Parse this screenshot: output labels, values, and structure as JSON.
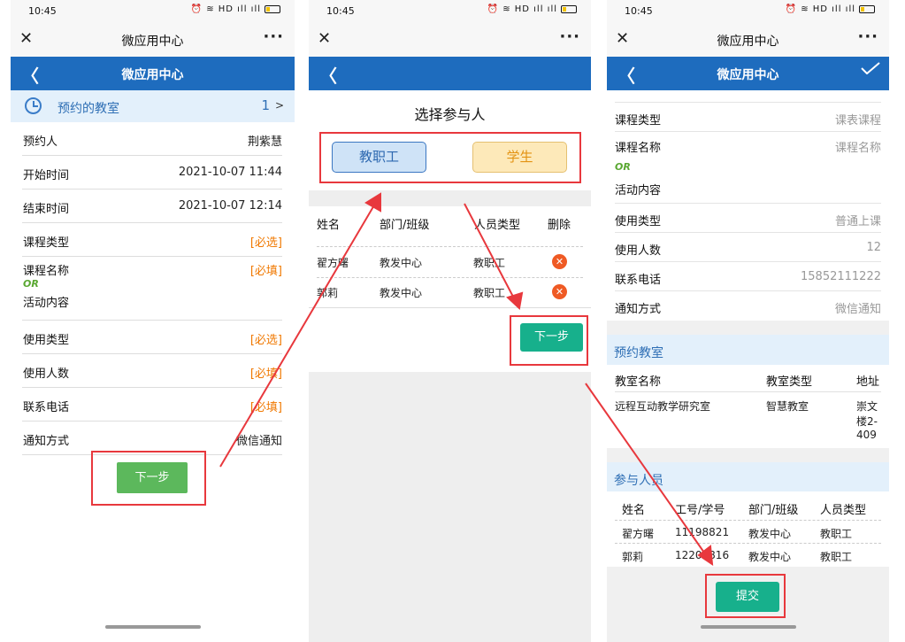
{
  "status_time": "10:45",
  "status_icons": "⏰ ≋ HD ıll ıll",
  "wechat": {
    "close": "✕",
    "title": "微应用中心",
    "more": "···"
  },
  "appbar_title": "微应用中心",
  "back_glyph": "〈",
  "panel1": {
    "reserve_label": "预约的教室",
    "reserve_count": "1",
    "reserve_arrow": ">",
    "rows": [
      {
        "key": "预约人",
        "value": "荆紫慧"
      },
      {
        "key": "开始时间",
        "value": "2021-10-07 11:44"
      },
      {
        "key": "结束时间",
        "value": "2021-10-07 12:14"
      },
      {
        "key": "课程类型",
        "value": "[必选]"
      },
      {
        "key": "课程名称",
        "or": "OR",
        "key2": "活动内容",
        "value": "[必填]"
      },
      {
        "key": "使用类型",
        "value": "[必选]"
      },
      {
        "key": "使用人数",
        "value": "[必填]"
      },
      {
        "key": "联系电话",
        "value": "[必填]"
      },
      {
        "key": "通知方式",
        "value": "微信通知"
      }
    ],
    "next_button": "下一步"
  },
  "panel2": {
    "title": "选择参与人",
    "type_staff": "教职工",
    "type_student": "学生",
    "headers": [
      "姓名",
      "部门/班级",
      "人员类型",
      "删除"
    ],
    "participants": [
      {
        "name": "翟方曙",
        "dept": "教发中心",
        "type": "教职工"
      },
      {
        "name": "郭莉",
        "dept": "教发中心",
        "type": "教职工"
      }
    ],
    "delete_glyph": "✕",
    "next_button": "下一步"
  },
  "panel3": {
    "rows": [
      {
        "key": "课程类型",
        "value": "课表课程"
      },
      {
        "key": "课程名称",
        "or": "OR",
        "key2": "活动内容",
        "value": "课程名称"
      },
      {
        "key": "使用类型",
        "value": "普通上课"
      },
      {
        "key": "使用人数",
        "value": "12"
      },
      {
        "key": "联系电话",
        "value": "15852111222"
      },
      {
        "key": "通知方式",
        "value": "微信通知"
      }
    ],
    "room_section": "预约教室",
    "room_headers": [
      "教室名称",
      "教室类型",
      "地址"
    ],
    "room": {
      "name": "远程互动教学研究室",
      "type": "智慧教室",
      "address": [
        "崇文",
        "楼2-",
        "409"
      ]
    },
    "participants_section": "参与人员",
    "participant_headers": [
      "姓名",
      "工号/学号",
      "部门/班级",
      "人员类型"
    ],
    "participants": [
      {
        "name": "翟方曙",
        "id": "11198821",
        "dept": "教发中心",
        "type": "教职工"
      },
      {
        "name": "郭莉",
        "id": "12201816",
        "dept": "教发中心",
        "type": "教职工"
      }
    ],
    "submit_button": "提交"
  },
  "colors": {
    "app_blue": "#1e6cbe",
    "required_orange": "#f07800",
    "next_green": "#5cb85c",
    "teal": "#17b08c",
    "annotation_red": "#e8383d"
  }
}
